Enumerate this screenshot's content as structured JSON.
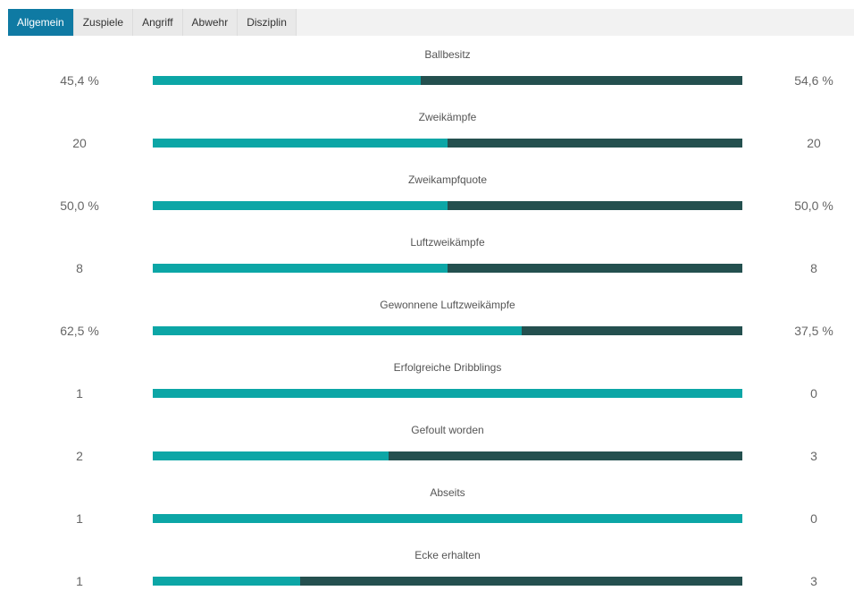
{
  "tabs": [
    {
      "label": "Allgemein",
      "active": true
    },
    {
      "label": "Zuspiele",
      "active": false
    },
    {
      "label": "Angriff",
      "active": false
    },
    {
      "label": "Abwehr",
      "active": false
    },
    {
      "label": "Disziplin",
      "active": false
    }
  ],
  "colors": {
    "home_bar": "#0ca6a6",
    "away_bar": "#24504f",
    "active_tab": "#0f7aa3"
  },
  "stats": [
    {
      "label": "Ballbesitz",
      "home": "45,4 %",
      "away": "54,6 %",
      "home_share": 0.454
    },
    {
      "label": "Zweikämpfe",
      "home": "20",
      "away": "20",
      "home_share": 0.5
    },
    {
      "label": "Zweikampfquote",
      "home": "50,0 %",
      "away": "50,0 %",
      "home_share": 0.5
    },
    {
      "label": "Luftzweikämpfe",
      "home": "8",
      "away": "8",
      "home_share": 0.5
    },
    {
      "label": "Gewonnene Luftzweikämpfe",
      "home": "62,5 %",
      "away": "37,5 %",
      "home_share": 0.625
    },
    {
      "label": "Erfolgreiche Dribblings",
      "home": "1",
      "away": "0",
      "home_share": 1.0
    },
    {
      "label": "Gefoult worden",
      "home": "2",
      "away": "3",
      "home_share": 0.4
    },
    {
      "label": "Abseits",
      "home": "1",
      "away": "0",
      "home_share": 1.0
    },
    {
      "label": "Ecke erhalten",
      "home": "1",
      "away": "3",
      "home_share": 0.25
    }
  ]
}
